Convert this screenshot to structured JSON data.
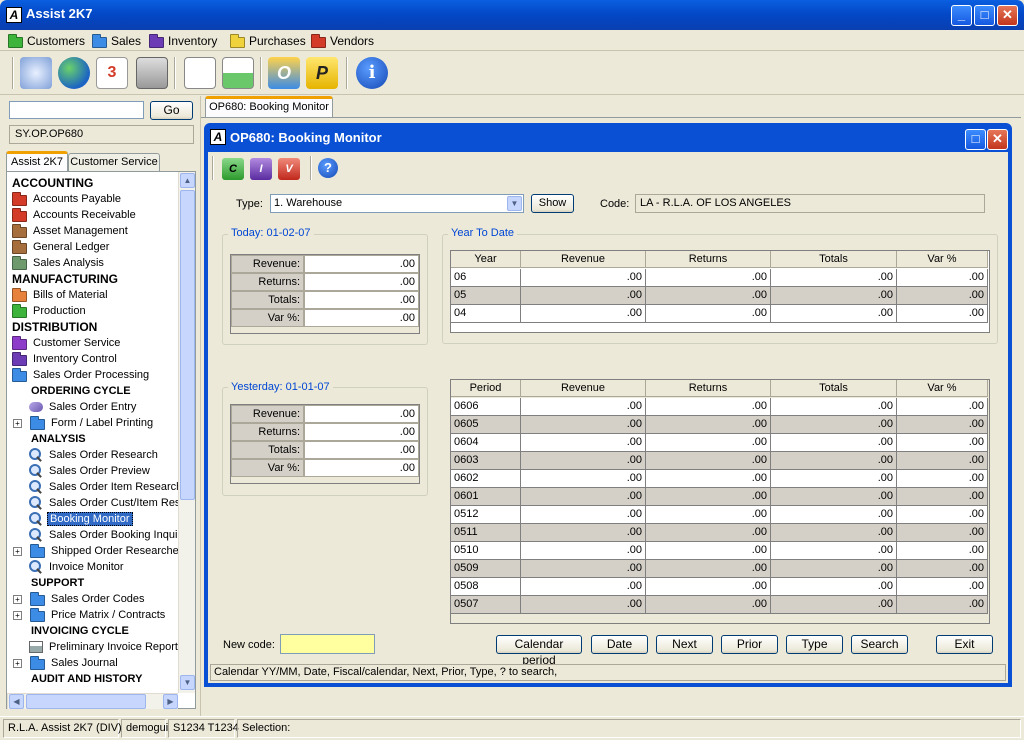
{
  "app": {
    "title": "Assist 2K7"
  },
  "menu": [
    {
      "label": "Customers",
      "color": "#3cb43c",
      "name": "menu-customers"
    },
    {
      "label": "Sales",
      "color": "#3c8ce6",
      "name": "menu-sales"
    },
    {
      "label": "Inventory",
      "color": "#6b3cb4",
      "name": "menu-inventory"
    },
    {
      "label": "Purchases",
      "color": "#f0d23c",
      "name": "menu-purchases"
    },
    {
      "label": "Vendors",
      "color": "#d23c28",
      "name": "menu-vendors"
    }
  ],
  "toolbar_icons": [
    "mail-icon",
    "globe-icon",
    "calendar-icon",
    "calculator-icon",
    "document-icon",
    "chart-icon",
    "outlook-icon",
    "p-icon",
    "info-icon"
  ],
  "left": {
    "search_value": "",
    "go_label": "Go",
    "path": "SY.OP.OP680",
    "tabs": [
      "Assist 2K7",
      "Customer Service"
    ]
  },
  "tree": [
    {
      "t": "head",
      "label": "ACCOUNTING"
    },
    {
      "t": "folder",
      "label": "Accounts Payable",
      "color": "#d23c28"
    },
    {
      "t": "folder",
      "label": "Accounts Receivable",
      "color": "#d23c28"
    },
    {
      "t": "folder",
      "label": "Asset Management",
      "color": "#a56e3c"
    },
    {
      "t": "folder",
      "label": "General Ledger",
      "color": "#a56e3c"
    },
    {
      "t": "folder",
      "label": "Sales Analysis",
      "color": "#6e9a6e"
    },
    {
      "t": "head",
      "label": "MANUFACTURING"
    },
    {
      "t": "folder",
      "label": "Bills of Material",
      "color": "#e6823c"
    },
    {
      "t": "folder",
      "label": "Production",
      "color": "#3cb43c"
    },
    {
      "t": "head",
      "label": "DISTRIBUTION"
    },
    {
      "t": "folder",
      "label": "Customer Service",
      "color": "#8c3cc8"
    },
    {
      "t": "folder",
      "label": "Inventory Control",
      "color": "#6b3cb4"
    },
    {
      "t": "folder",
      "label": "Sales Order Processing",
      "color": "#3c8ce6"
    },
    {
      "t": "sub",
      "label": "ORDERING CYCLE"
    },
    {
      "t": "item",
      "label": "Sales Order Entry",
      "icon": "entry"
    },
    {
      "t": "exp",
      "label": "Form / Label Printing"
    },
    {
      "t": "sub",
      "label": "ANALYSIS"
    },
    {
      "t": "item",
      "label": "Sales Order Research",
      "icon": "mag"
    },
    {
      "t": "item",
      "label": "Sales Order Preview",
      "icon": "mag"
    },
    {
      "t": "item",
      "label": "Sales Order Item Research",
      "icon": "mag"
    },
    {
      "t": "item",
      "label": "Sales Order Cust/Item Res",
      "icon": "mag"
    },
    {
      "t": "item",
      "label": "Booking Monitor",
      "icon": "mag",
      "selected": true
    },
    {
      "t": "item",
      "label": "Sales Order Booking Inquir",
      "icon": "mag"
    },
    {
      "t": "exp",
      "label": "Shipped Order Researches"
    },
    {
      "t": "item",
      "label": "Invoice Monitor",
      "icon": "mag"
    },
    {
      "t": "sub",
      "label": "SUPPORT"
    },
    {
      "t": "exp",
      "label": "Sales Order Codes"
    },
    {
      "t": "exp",
      "label": "Price Matrix / Contracts"
    },
    {
      "t": "sub",
      "label": "INVOICING CYCLE"
    },
    {
      "t": "item",
      "label": "Preliminary Invoice Report",
      "icon": "printer"
    },
    {
      "t": "exp",
      "label": "Sales Journal"
    },
    {
      "t": "sub",
      "label": "AUDIT AND HISTORY"
    }
  ],
  "doc_tab": "OP680: Booking Monitor",
  "inner": {
    "title": "OP680: Booking Monitor",
    "type_label": "Type:",
    "type_value": "1. Warehouse",
    "show_label": "Show",
    "code_label": "Code:",
    "code_value": "LA - R.L.A. OF LOS ANGELES",
    "today_title": "Today: 01-02-07",
    "yesterday_title": "Yesterday: 01-01-07",
    "summary_labels": [
      "Revenue:",
      "Returns:",
      "Totals:",
      "Var %:"
    ],
    "today_values": [
      ".00",
      ".00",
      ".00",
      ".00"
    ],
    "yesterday_values": [
      ".00",
      ".00",
      ".00",
      ".00"
    ],
    "ytd_title": "Year To Date",
    "ytd_headers": [
      "Year",
      "Revenue",
      "Returns",
      "Totals",
      "Var %"
    ],
    "ytd_rows": [
      [
        "06",
        ".00",
        ".00",
        ".00",
        ".00"
      ],
      [
        "05",
        ".00",
        ".00",
        ".00",
        ".00"
      ],
      [
        "04",
        ".00",
        ".00",
        ".00",
        ".00"
      ]
    ],
    "period_headers": [
      "Period",
      "Revenue",
      "Returns",
      "Totals",
      "Var %"
    ],
    "period_rows": [
      [
        "0606",
        ".00",
        ".00",
        ".00",
        ".00"
      ],
      [
        "0605",
        ".00",
        ".00",
        ".00",
        ".00"
      ],
      [
        "0604",
        ".00",
        ".00",
        ".00",
        ".00"
      ],
      [
        "0603",
        ".00",
        ".00",
        ".00",
        ".00"
      ],
      [
        "0602",
        ".00",
        ".00",
        ".00",
        ".00"
      ],
      [
        "0601",
        ".00",
        ".00",
        ".00",
        ".00"
      ],
      [
        "0512",
        ".00",
        ".00",
        ".00",
        ".00"
      ],
      [
        "0511",
        ".00",
        ".00",
        ".00",
        ".00"
      ],
      [
        "0510",
        ".00",
        ".00",
        ".00",
        ".00"
      ],
      [
        "0509",
        ".00",
        ".00",
        ".00",
        ".00"
      ],
      [
        "0508",
        ".00",
        ".00",
        ".00",
        ".00"
      ],
      [
        "0507",
        ".00",
        ".00",
        ".00",
        ".00"
      ]
    ],
    "new_code_label": "New code:",
    "new_code_value": "",
    "buttons": [
      "Calendar period",
      "Date",
      "Next",
      "Prior",
      "Type",
      "Search",
      "Exit"
    ],
    "hint": "Calendar YY/MM,  Date,  Fiscal/calendar,  Next,  Prior,  Type,  ? to search,"
  },
  "status": {
    "company": "R.L.A. Assist 2K7 (DIV)",
    "user": "demogui",
    "terminal": "S1234 T1234",
    "selection": "Selection:"
  }
}
